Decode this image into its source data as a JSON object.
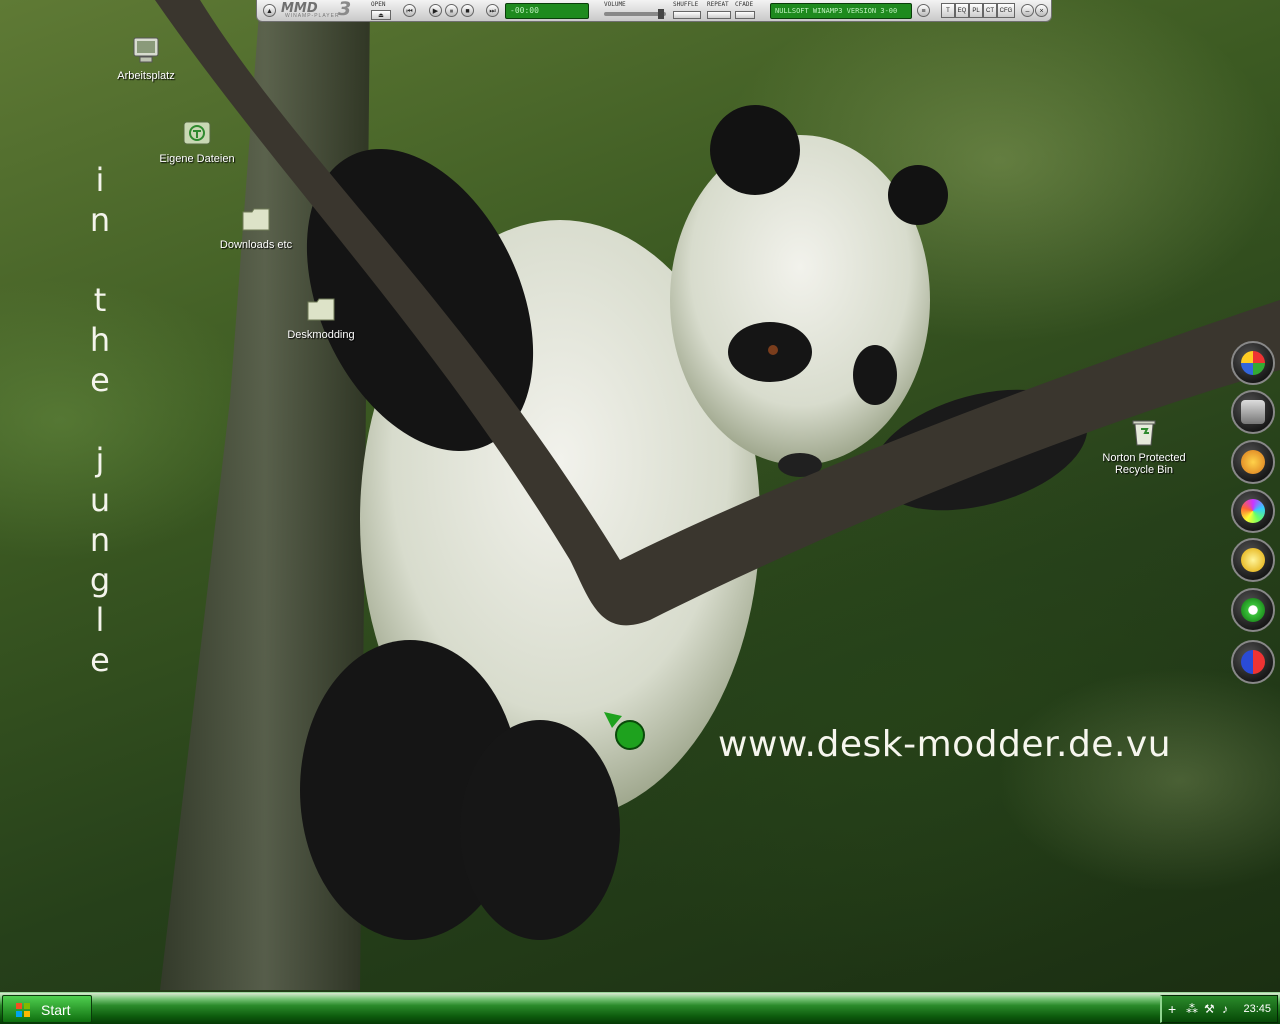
{
  "wallpaper": {
    "slogan": [
      "i",
      "n",
      "",
      "t",
      "h",
      "e",
      "",
      "j",
      "u",
      "n",
      "g",
      "l",
      "e"
    ],
    "website": "www.desk-modder.de.vu"
  },
  "desktop_icons": [
    {
      "id": "arbeitsplatz",
      "label": "Arbeitsplatz",
      "icon": "computer-icon"
    },
    {
      "id": "eigene-dateien",
      "label": "Eigene Dateien",
      "icon": "documents-folder-icon"
    },
    {
      "id": "downloads",
      "label": "Downloads etc",
      "icon": "folder-icon"
    },
    {
      "id": "deskmodding",
      "label": "Deskmodding",
      "icon": "folder-icon"
    },
    {
      "id": "recycle-bin",
      "label": "Norton Protected Recycle Bin",
      "label_line1": "Norton Protected",
      "label_line2": "Recycle Bin",
      "icon": "recycle-bin-icon"
    }
  ],
  "winamp": {
    "logo": "MMD",
    "logo_version": "3",
    "subtitle": "WINAMP-PLAYER",
    "open_label": "OPEN",
    "time": "-00:00",
    "volume_label": "VOLUME",
    "shuffle_label": "SHUFFLE",
    "repeat_label": "REPEAT",
    "crossfade_label": "CFADE",
    "track_title": "NULLSOFT WINAMP3 VERSION 3-00",
    "buttons": [
      "T",
      "EQ",
      "PL",
      "CT",
      "CFG"
    ],
    "accent": "#1e8a1e"
  },
  "dock": {
    "items": [
      "messenger-icon",
      "stack-icon",
      "fish-icon",
      "media-icon",
      "lightning-icon",
      "icq-icon",
      "game-icon"
    ]
  },
  "taskbar": {
    "start_label": "Start",
    "clock": "23:45",
    "tray_icons": [
      "add-icon",
      "network-icon",
      "tools-icon",
      "volume-icon"
    ],
    "accent": "#0d5c0d"
  }
}
